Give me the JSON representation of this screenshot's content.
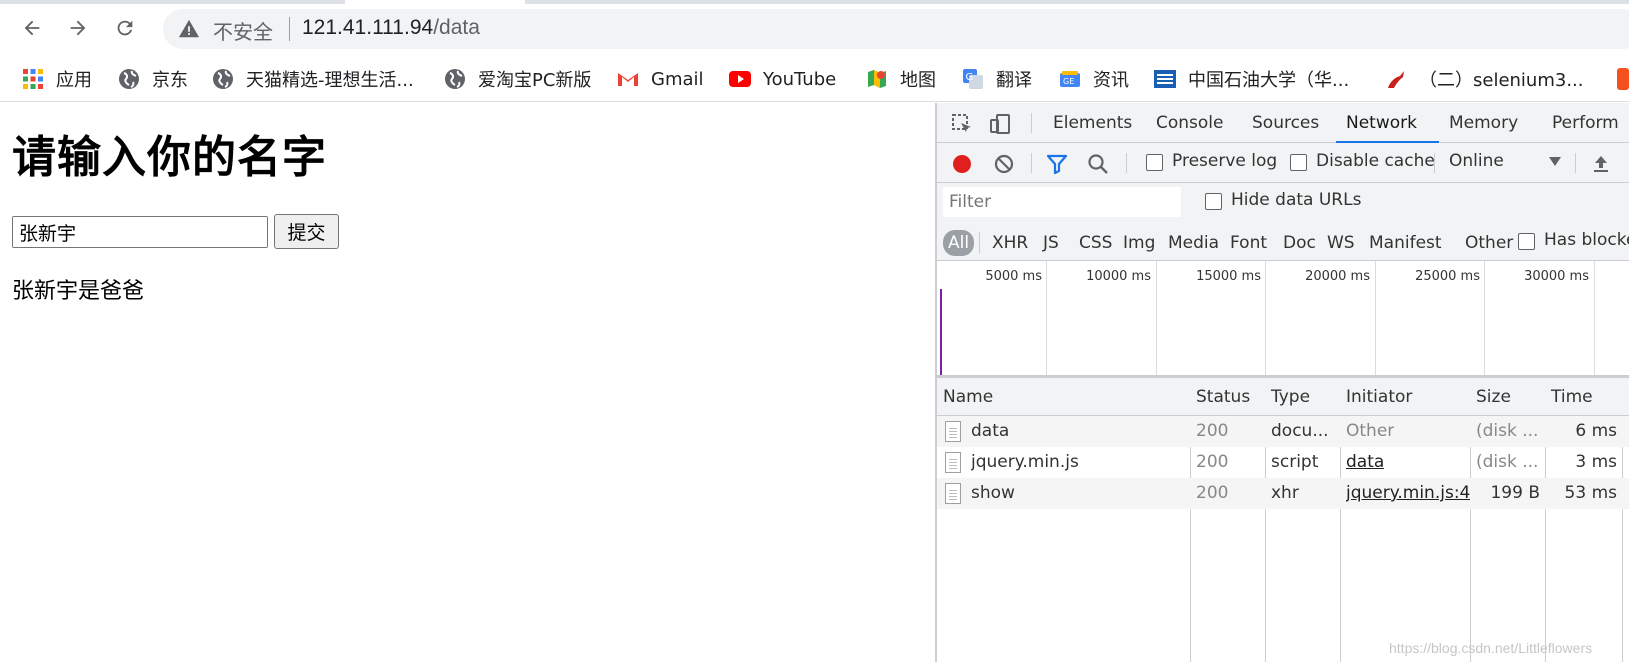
{
  "browser": {
    "security_label": "不安全",
    "url_host": "121.41.111.94",
    "url_path": "/data"
  },
  "bookmarks": [
    {
      "label": "应用",
      "icon": "apps-grid-icon"
    },
    {
      "label": "京东",
      "icon": "globe-icon"
    },
    {
      "label": "天猫精选-理想生活...",
      "icon": "globe-icon"
    },
    {
      "label": "爱淘宝PC新版",
      "icon": "globe-icon"
    },
    {
      "label": "Gmail",
      "icon": "gmail-icon"
    },
    {
      "label": "YouTube",
      "icon": "youtube-icon"
    },
    {
      "label": "地图",
      "icon": "maps-icon"
    },
    {
      "label": "翻译",
      "icon": "translate-icon"
    },
    {
      "label": "资讯",
      "icon": "news-icon"
    },
    {
      "label": "中国石油大学（华...",
      "icon": "university-icon"
    },
    {
      "label": "（二）selenium3...",
      "icon": "bird-icon"
    }
  ],
  "page": {
    "heading": "请输入你的名字",
    "input_value": "张新宇",
    "submit_label": "提交",
    "result": "张新宇是爸爸"
  },
  "devtools": {
    "tabs": [
      "Elements",
      "Console",
      "Sources",
      "Network",
      "Memory",
      "Perform"
    ],
    "active_tab": "Network",
    "controls": {
      "preserve_log": "Preserve log",
      "disable_cache": "Disable cache",
      "throttle": "Online"
    },
    "filter": {
      "placeholder": "Filter",
      "hide_data_urls": "Hide data URLs",
      "has_blocked": "Has blocke"
    },
    "types": [
      "All",
      "XHR",
      "JS",
      "CSS",
      "Img",
      "Media",
      "Font",
      "Doc",
      "WS",
      "Manifest",
      "Other"
    ],
    "timeline_labels": [
      "5000 ms",
      "10000 ms",
      "15000 ms",
      "20000 ms",
      "25000 ms",
      "30000 ms"
    ],
    "columns": [
      "Name",
      "Status",
      "Type",
      "Initiator",
      "Size",
      "Time"
    ],
    "rows": [
      {
        "name": "data",
        "status": "200",
        "type": "docu...",
        "initiator": "Other",
        "size": "(disk ...",
        "time": "6 ms"
      },
      {
        "name": "jquery.min.js",
        "status": "200",
        "type": "script",
        "initiator": "data",
        "size": "(disk ...",
        "time": "3 ms"
      },
      {
        "name": "show",
        "status": "200",
        "type": "xhr",
        "initiator": "jquery.min.js:4",
        "size": "199 B",
        "time": "53 ms"
      }
    ]
  },
  "watermark": "https://blog.csdn.net/Littleflowers"
}
